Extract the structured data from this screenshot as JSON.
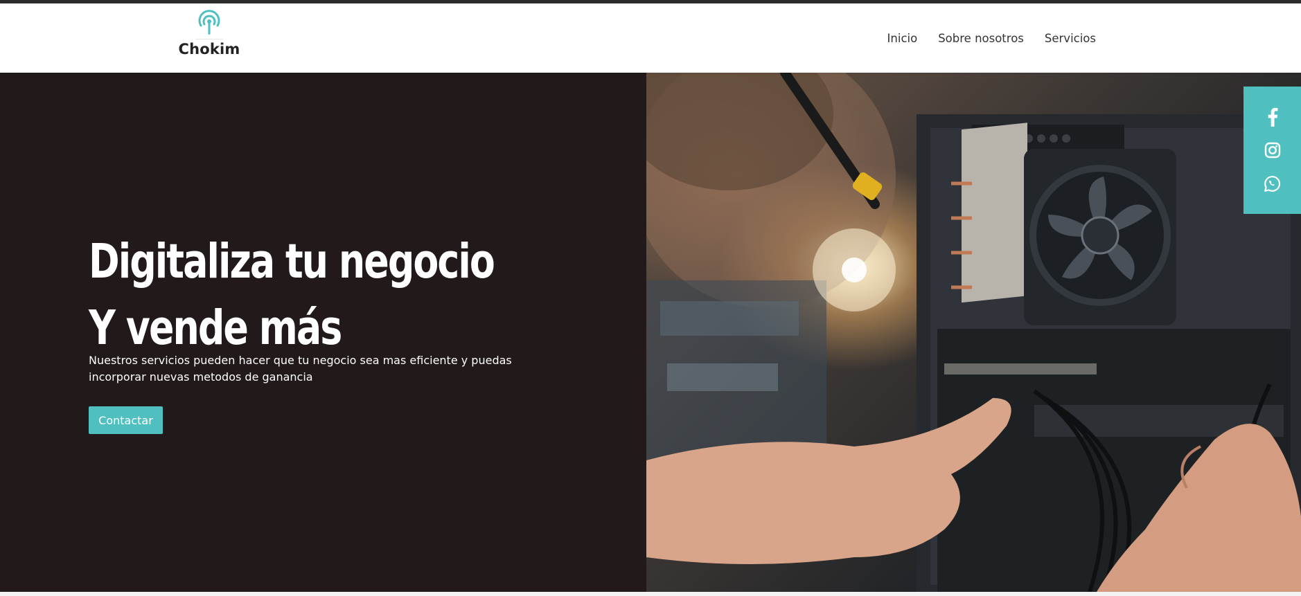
{
  "brand": {
    "name": "Chokim",
    "logo_icon": "broadcast-signal-icon",
    "accent_color": "#4fbfbf"
  },
  "nav": {
    "items": [
      {
        "label": "Inicio"
      },
      {
        "label": "Sobre nosotros"
      },
      {
        "label": "Servicios"
      }
    ]
  },
  "hero": {
    "title_line1": "Digitaliza tu negocio",
    "title_line2": "Y vende más",
    "description": "Nuestros servicios pueden hacer que tu negocio sea mas eficiente y puedas incorporar nuevas metodos de ganancia",
    "cta_label": "Contactar",
    "background_color": "#221a1a",
    "image_subject": "technician hands installing components in computer case with CPU cooler fan"
  },
  "social": {
    "background_color": "#4fbfbf",
    "icons": [
      "facebook-icon",
      "instagram-icon",
      "whatsapp-icon"
    ]
  }
}
